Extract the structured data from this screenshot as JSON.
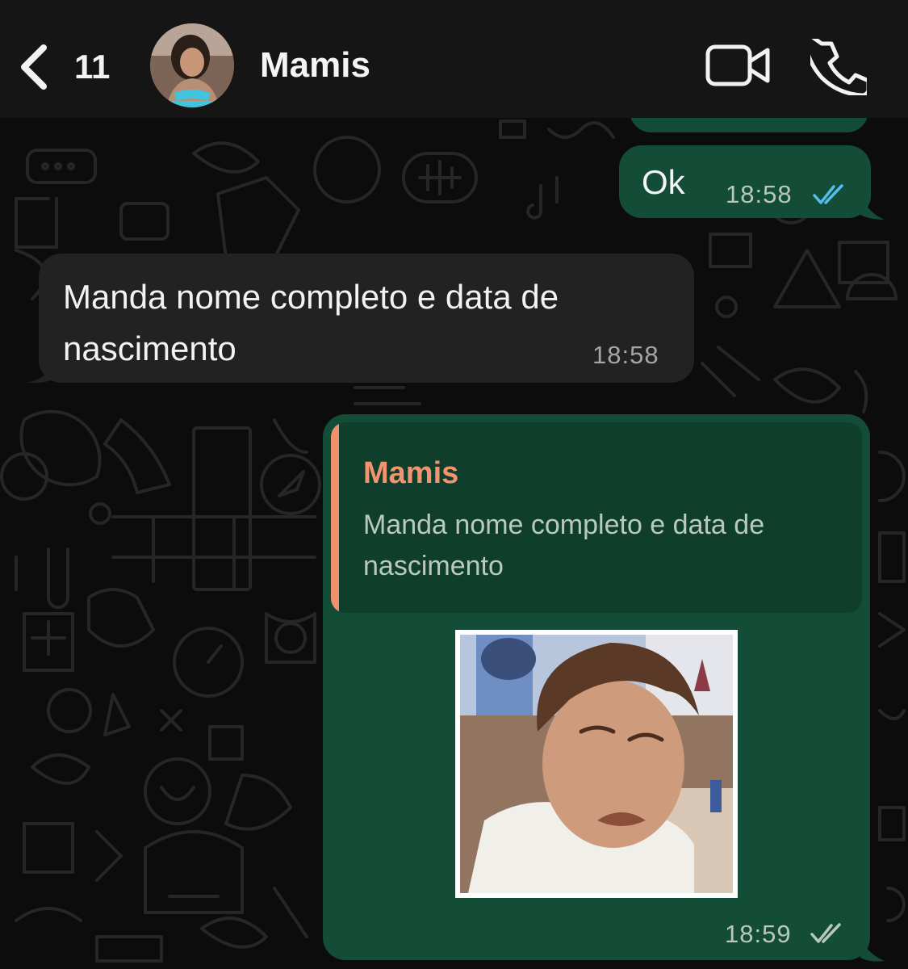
{
  "header": {
    "back_count": "11",
    "contact_name": "Mamis"
  },
  "messages": {
    "ok": {
      "text": "Ok",
      "time": "18:58",
      "status": "read"
    },
    "incoming": {
      "text": "Manda nome completo e data de nascimento",
      "time": "18:58"
    },
    "reply": {
      "quote_author": "Mamis",
      "quote_text": "Manda nome completo e data de nascimento",
      "time": "18:59",
      "status": "delivered"
    }
  },
  "colors": {
    "outgoing_bubble": "#134d37",
    "incoming_bubble": "#222222",
    "quote_accent": "#f0916c",
    "read_ticks": "#53bdeb",
    "delivered_ticks": "#b8c7bf"
  },
  "icons": {
    "back": "chevron-left-icon",
    "video": "video-camera-icon",
    "call": "phone-icon",
    "read_receipt": "double-check-icon"
  }
}
